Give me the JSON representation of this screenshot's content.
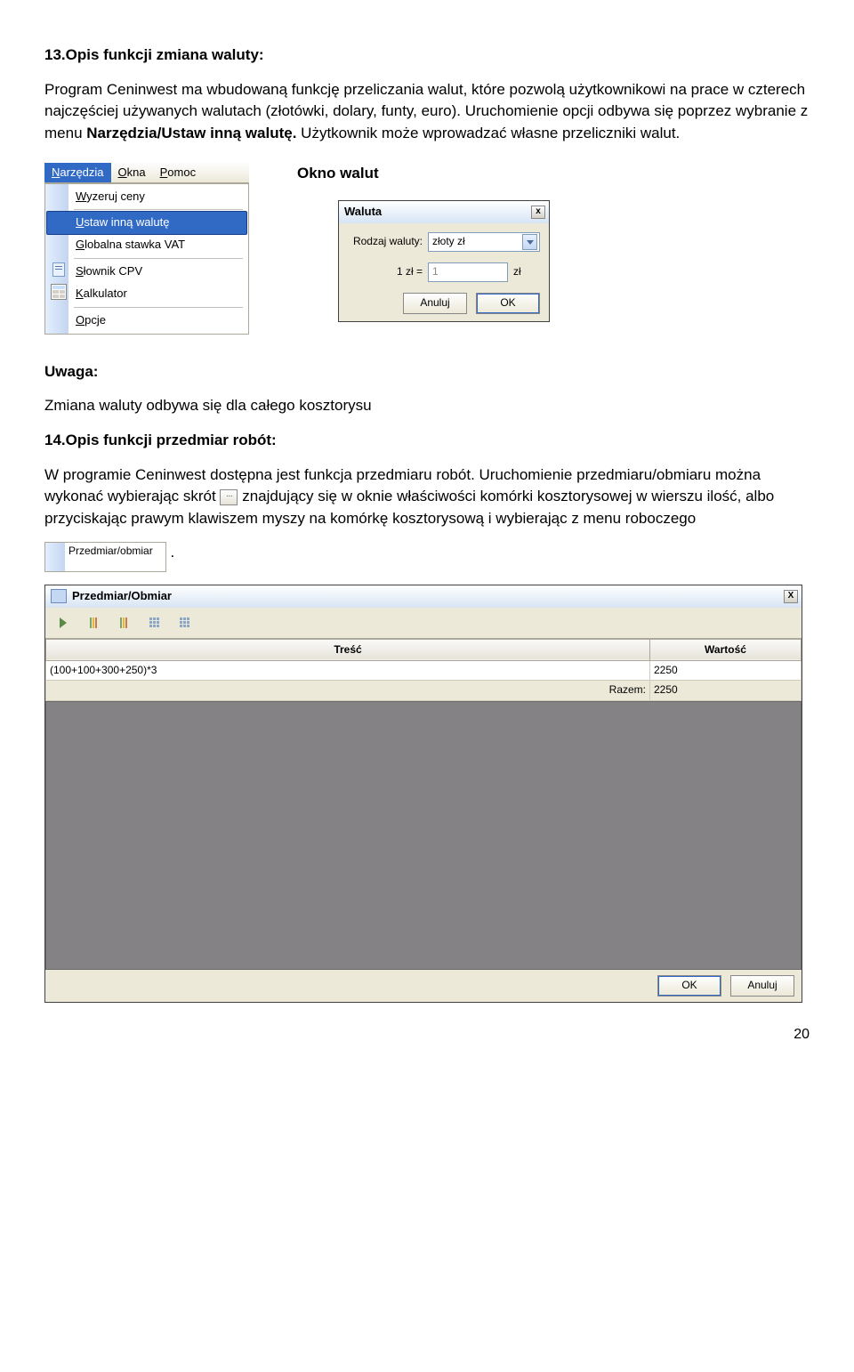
{
  "section13": {
    "heading": "13.Opis funkcji zmiana waluty:",
    "para1a": "Program Ceninwest ma wbudowaną funkcję przeliczania walut, które pozwolą użytkownikowi na prace w czterech najczęściej używanych walutach (złotówki, dolary, funty, euro). Uruchomienie opcji odbywa się poprzez wybranie z menu ",
    "boldMenu": "Narzędzia/Ustaw inną walutę.",
    "para1b": " Użytkownik może wprowadzać własne przeliczniki walut."
  },
  "menu": {
    "bar": {
      "narz": "Narzędzia",
      "okna": "Okna",
      "pomoc": "Pomoc"
    },
    "items": {
      "wyzeruj": "Wyzeruj ceny",
      "ustaw": "Ustaw inną walutę",
      "vat": "Globalna stawka VAT",
      "cpv": "Słownik CPV",
      "kalk": "Kalkulator",
      "opcje": "Opcje"
    }
  },
  "col2Caption": "Okno walut",
  "walutaDlg": {
    "title": "Waluta",
    "closeX": "x",
    "lblRodzaj": "Rodzaj waluty:",
    "comboValue": "złoty zł",
    "eqLeft": "1 zł  =",
    "eqVal": "1",
    "eqUnit": "zł",
    "anuluj": "Anuluj",
    "ok": "OK"
  },
  "uwaga": {
    "label": "Uwaga:",
    "text": "Zmiana waluty odbywa się dla całego kosztorysu"
  },
  "section14": {
    "heading": "14.Opis funkcji przedmiar robót:",
    "p1": "W programie Ceninwest dostępna jest funkcja przedmiaru robót. Uruchomienie przedmiaru/obmiaru można wykonać wybierając skrót ",
    "tinyBtn": "···",
    "p2": " znajdujący się w oknie właściwości komórki kosztorysowej w wierszu ilość, albo przyciskając prawym klawiszem myszy na komórkę kosztorysową i wybierając z menu roboczego",
    "ctx": "Przedmiar/obmiar",
    "dot": "."
  },
  "poWin": {
    "title": "Przedmiar/Obmiar",
    "colTresc": "Treść",
    "colWartosc": "Wartość",
    "rowCalc": "(100+100+300+250)*3",
    "rowVal": "2250",
    "razemLabel": "Razem:",
    "razemVal": "2250",
    "ok": "OK",
    "anuluj": "Anuluj",
    "closeX": "X"
  },
  "pageNumber": "20"
}
